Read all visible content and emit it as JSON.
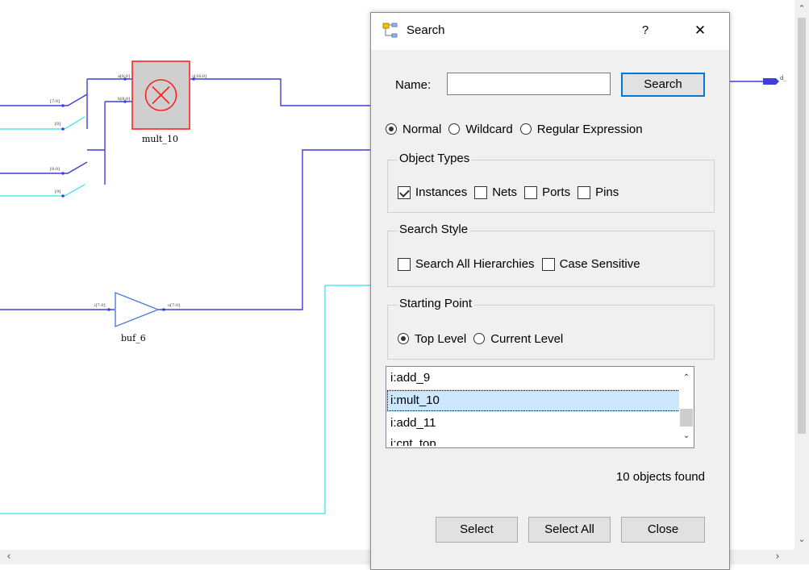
{
  "schematic": {
    "instances": [
      {
        "name": "mult_10",
        "pins": [
          "a[8:0]",
          "b[8:0]",
          "o[16:0]"
        ]
      },
      {
        "name": "buf_6",
        "pins": [
          "i[7:0]",
          "o[7:0]"
        ]
      }
    ],
    "net_labels": [
      "[7:0]",
      "[8]",
      "[8:0]",
      "[9]"
    ],
    "port_label": "d_"
  },
  "dialog": {
    "title": "Search",
    "help": "?",
    "close": "✕",
    "name_label": "Name:",
    "name_value": "",
    "search_button": "Search",
    "mode_options": [
      {
        "label": "Normal",
        "selected": true
      },
      {
        "label": "Wildcard",
        "selected": false
      },
      {
        "label": "Regular Expression",
        "selected": false
      }
    ],
    "object_types": {
      "title": "Object Types",
      "options": [
        {
          "label": "Instances",
          "checked": true
        },
        {
          "label": "Nets",
          "checked": false
        },
        {
          "label": "Ports",
          "checked": false
        },
        {
          "label": "Pins",
          "checked": false
        }
      ]
    },
    "search_style": {
      "title": "Search Style",
      "options": [
        {
          "label": "Search All Hierarchies",
          "checked": false
        },
        {
          "label": "Case Sensitive",
          "checked": false
        }
      ]
    },
    "starting_point": {
      "title": "Starting Point",
      "options": [
        {
          "label": "Top Level",
          "selected": true
        },
        {
          "label": "Current Level",
          "selected": false
        }
      ]
    },
    "results": [
      "i:add_9",
      "i:mult_10",
      "i:add_11",
      "i:cnt_top"
    ],
    "selected_result": "i:mult_10",
    "status": "10 objects found",
    "buttons": {
      "select": "Select",
      "select_all": "Select All",
      "close": "Close"
    }
  },
  "colors": {
    "net_blue": "#3f3fd8",
    "net_cyan": "#2fe0f0",
    "mult_fill": "#cfcfcf",
    "mult_border": "#ff2020",
    "buffer": "#4a7fd8",
    "selection": "#cce8ff",
    "accent": "#0078d7"
  },
  "icons": [
    "search-tree-icon",
    "help-icon",
    "close-icon",
    "chevron-up-icon",
    "chevron-down-icon",
    "chevron-left-icon",
    "chevron-right-icon"
  ]
}
